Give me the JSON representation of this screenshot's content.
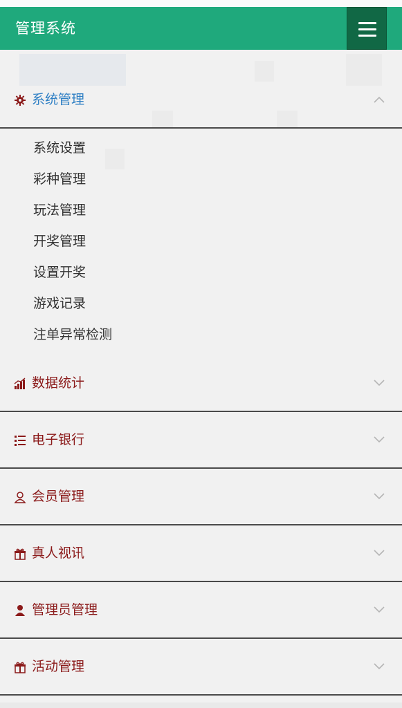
{
  "navbar": {
    "brand": "管理系统",
    "accent_color": "#1fa97c",
    "toggle_icon": "hamburger-menu-icon"
  },
  "menu": {
    "groups": [
      {
        "label": "系统管理",
        "icon": "gear-icon",
        "expanded": true,
        "items": [
          "系统设置",
          "彩种管理",
          "玩法管理",
          "开奖管理",
          "设置开奖",
          "游戏记录",
          "注单异常检测"
        ]
      },
      {
        "label": "数据统计",
        "icon": "bar-chart-icon",
        "expanded": false
      },
      {
        "label": "电子银行",
        "icon": "list-icon",
        "expanded": false
      },
      {
        "label": "会员管理",
        "icon": "user-outline-icon",
        "expanded": false
      },
      {
        "label": "真人视讯",
        "icon": "gift-icon",
        "expanded": false
      },
      {
        "label": "管理员管理",
        "icon": "user-filled-icon",
        "expanded": false
      },
      {
        "label": "活动管理",
        "icon": "gift-icon",
        "expanded": false
      }
    ]
  }
}
